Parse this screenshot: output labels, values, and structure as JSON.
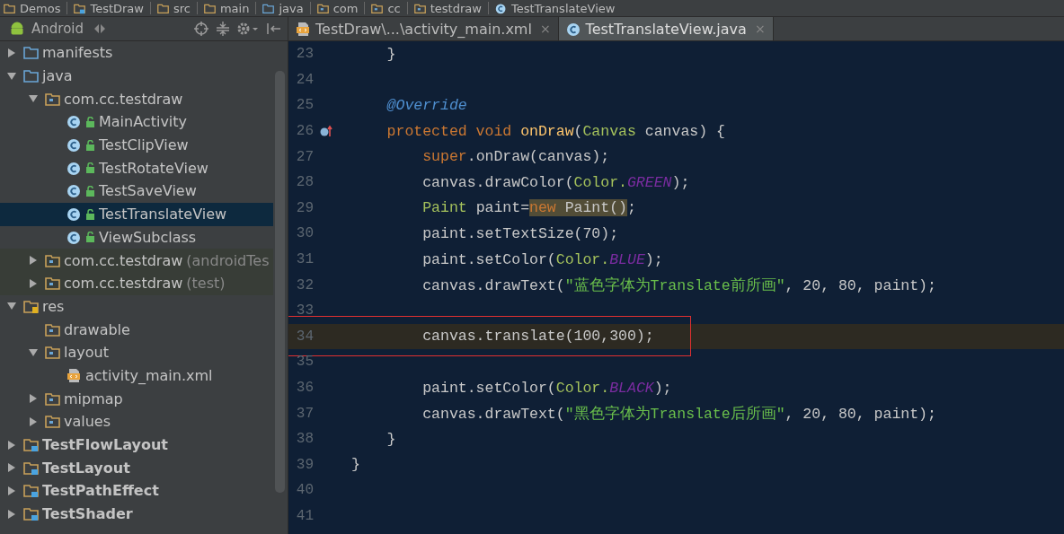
{
  "breadcrumbs": [
    {
      "label": "Demos",
      "kind": "folder"
    },
    {
      "label": "TestDraw",
      "kind": "module"
    },
    {
      "label": "src",
      "kind": "folder"
    },
    {
      "label": "main",
      "kind": "folder"
    },
    {
      "label": "java",
      "kind": "source"
    },
    {
      "label": "com",
      "kind": "package"
    },
    {
      "label": "cc",
      "kind": "package"
    },
    {
      "label": "testdraw",
      "kind": "package"
    },
    {
      "label": "TestTranslateView",
      "kind": "class"
    }
  ],
  "project_panel": {
    "view": "Android",
    "tree": [
      {
        "label": "manifests",
        "kind": "source",
        "expanded": false
      },
      {
        "label": "java",
        "kind": "source",
        "expanded": true,
        "children": [
          {
            "label": "com.cc.testdraw",
            "kind": "package",
            "expanded": true,
            "children": [
              {
                "label": "MainActivity",
                "kind": "class",
                "selected": false
              },
              {
                "label": "TestClipView",
                "kind": "class",
                "selected": false
              },
              {
                "label": "TestRotateView",
                "kind": "class",
                "selected": false
              },
              {
                "label": "TestSaveView",
                "kind": "class",
                "selected": false
              },
              {
                "label": "TestTranslateView",
                "kind": "class",
                "selected": true
              },
              {
                "label": "ViewSubclass",
                "kind": "class",
                "selected": false
              }
            ]
          },
          {
            "label": "com.cc.testdraw",
            "suffix": "(androidTes",
            "kind": "package",
            "test_scope": true,
            "expanded": false
          },
          {
            "label": "com.cc.testdraw",
            "suffix": "(test)",
            "kind": "package",
            "test_scope": true,
            "expanded": false
          }
        ]
      },
      {
        "label": "res",
        "kind": "res",
        "expanded": true,
        "children": [
          {
            "label": "drawable",
            "kind": "package"
          },
          {
            "label": "layout",
            "kind": "package",
            "expanded": true,
            "children": [
              {
                "label": "activity_main.xml",
                "kind": "xml",
                "selected": false
              }
            ]
          },
          {
            "label": "mipmap",
            "kind": "package",
            "expanded": false
          },
          {
            "label": "values",
            "kind": "package",
            "expanded": false
          }
        ]
      },
      {
        "label": "TestFlowLayout",
        "kind": "module",
        "expanded": false
      },
      {
        "label": "TestLayout",
        "kind": "module",
        "expanded": false
      },
      {
        "label": "TestPathEffect",
        "kind": "module",
        "expanded": false
      },
      {
        "label": "TestShader",
        "kind": "module",
        "expanded": false
      }
    ]
  },
  "tabs": [
    {
      "label": "TestDraw\\...\\activity_main.xml",
      "kind": "xml",
      "close": "×",
      "selected": false
    },
    {
      "label": "TestTranslateView.java",
      "kind": "class",
      "close": "×",
      "selected": true
    }
  ],
  "editor": {
    "lines": [
      {
        "number": "23",
        "tokens": [
          {
            "text": "    }",
            "kind": "plain"
          }
        ]
      },
      {
        "number": "24"
      },
      {
        "number": "25",
        "tokens": [
          {
            "text": "    @Override",
            "kind": "annotation"
          }
        ]
      },
      {
        "number": "26",
        "override_marker": true,
        "tokens": [
          {
            "text": "    protected void ",
            "kind": "keyword"
          },
          {
            "text": "onDraw",
            "kind": "method"
          },
          {
            "text": "(",
            "kind": "plain"
          },
          {
            "text": "Canvas",
            "kind": "type"
          },
          {
            "text": " canvas) {",
            "kind": "plain"
          }
        ]
      },
      {
        "number": "27",
        "tokens": [
          {
            "text": "        super",
            "kind": "keyword"
          },
          {
            "text": ".onDraw(canvas);",
            "kind": "plain"
          }
        ]
      },
      {
        "number": "28",
        "tokens": [
          {
            "text": "        canvas.drawColor(",
            "kind": "plain"
          },
          {
            "text": "Color.",
            "kind": "type"
          },
          {
            "text": "GREEN",
            "kind": "constant"
          },
          {
            "text": ");",
            "kind": "plain"
          }
        ]
      },
      {
        "number": "29",
        "tokens": [
          {
            "text": "        Paint",
            "kind": "type"
          },
          {
            "text": " paint=",
            "kind": "plain"
          },
          {
            "text": "new",
            "kind": "keyword",
            "match": true
          },
          {
            "text": " Paint()",
            "kind": "plain",
            "match": true
          },
          {
            "text": ";",
            "kind": "plain"
          }
        ]
      },
      {
        "number": "30",
        "tokens": [
          {
            "text": "        paint.setTextSize(70);",
            "kind": "plain"
          }
        ]
      },
      {
        "number": "31",
        "tokens": [
          {
            "text": "        paint.setColor(",
            "kind": "plain"
          },
          {
            "text": "Color.",
            "kind": "type"
          },
          {
            "text": "BLUE",
            "kind": "constant"
          },
          {
            "text": ");",
            "kind": "plain"
          }
        ]
      },
      {
        "number": "32",
        "tokens": [
          {
            "text": "        canvas.drawText(",
            "kind": "plain"
          },
          {
            "text": "\"蓝色字体为Translate前所画\"",
            "kind": "string"
          },
          {
            "text": ", 20, 80, paint);",
            "kind": "plain"
          }
        ]
      },
      {
        "number": "33"
      },
      {
        "number": "34",
        "current": true,
        "boxed": true,
        "tokens": [
          {
            "text": "        canvas.translate(100,300);",
            "kind": "plain"
          }
        ]
      },
      {
        "number": "35"
      },
      {
        "number": "36",
        "tokens": [
          {
            "text": "        paint.setColor(",
            "kind": "plain"
          },
          {
            "text": "Color.",
            "kind": "type"
          },
          {
            "text": "BLACK",
            "kind": "constant"
          },
          {
            "text": ");",
            "kind": "plain"
          }
        ]
      },
      {
        "number": "37",
        "tokens": [
          {
            "text": "        canvas.drawText(",
            "kind": "plain"
          },
          {
            "text": "\"黑色字体为Translate后所画\"",
            "kind": "string"
          },
          {
            "text": ", 20, 80, paint);",
            "kind": "plain"
          }
        ]
      },
      {
        "number": "38",
        "tokens": [
          {
            "text": "    }",
            "kind": "plain"
          }
        ]
      },
      {
        "number": "39",
        "tokens": [
          {
            "text": "}",
            "kind": "plain"
          }
        ]
      },
      {
        "number": "40"
      },
      {
        "number": "41"
      }
    ]
  }
}
